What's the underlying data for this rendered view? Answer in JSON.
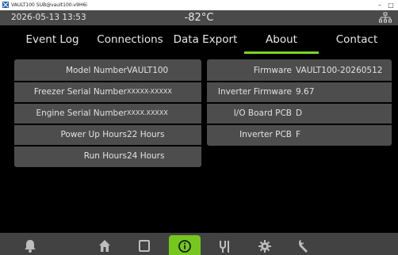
{
  "window": {
    "title": "VAULT100 SUB@vault100-v9H6i",
    "controls": {
      "minimize": "–",
      "maximize": "□"
    }
  },
  "header": {
    "datetime": "2026-05-13  13:53",
    "temperature": "-82°C",
    "network_icon": "network-icon"
  },
  "tabs": [
    {
      "label": "Event Log",
      "active": false
    },
    {
      "label": "Connections",
      "active": false
    },
    {
      "label": "Data Export",
      "active": false
    },
    {
      "label": "About",
      "active": true
    },
    {
      "label": "Contact",
      "active": false
    }
  ],
  "about": {
    "left": [
      {
        "label": "Model Number",
        "value": "VAULT100"
      },
      {
        "label": "Freezer Serial Number",
        "value": "XXXXX-XXXXX"
      },
      {
        "label": "Engine Serial Number",
        "value": "XXXX.XXXXX"
      },
      {
        "label": "Power Up Hours",
        "value": "22 Hours"
      },
      {
        "label": "Run Hours",
        "value": "24 Hours"
      }
    ],
    "right": [
      {
        "label": "Firmware",
        "value": "VAULT100-20260512"
      },
      {
        "label": "Inverter Firmware",
        "value": "9.67"
      },
      {
        "label": "I/O Board PCB",
        "value": "D"
      },
      {
        "label": "Inverter PCB",
        "value": "F"
      }
    ]
  },
  "bottom_nav": [
    {
      "icon": "bell-icon",
      "active": false
    },
    {
      "icon": "home-icon",
      "active": false
    },
    {
      "icon": "square-icon",
      "active": false
    },
    {
      "icon": "info-icon",
      "active": true
    },
    {
      "icon": "tools-icon",
      "active": false
    },
    {
      "icon": "gear-icon",
      "active": false
    },
    {
      "icon": "wrench-icon",
      "active": false
    }
  ],
  "colors": {
    "accent_green": "#7fd321",
    "panel": "#4d4d4d",
    "header": "#4a4a4a",
    "nav": "#424242"
  }
}
